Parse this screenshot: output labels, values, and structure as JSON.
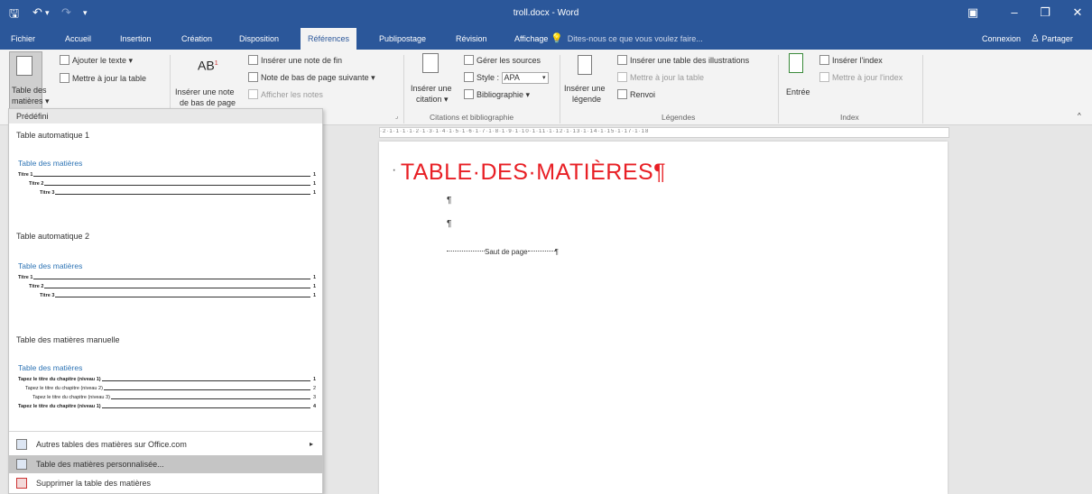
{
  "window": {
    "title": "troll.docx - Word",
    "quick_access": {
      "save_icon": "save-icon",
      "undo_icon": "undo-icon",
      "redo_icon": "redo-icon",
      "customize_icon": "customize-icon"
    },
    "controls": {
      "ribbon_display": "▣",
      "minimize": "–",
      "restore": "❐",
      "close": "✕"
    }
  },
  "tabs": [
    "Fichier",
    "Accueil",
    "Insertion",
    "Création",
    "Disposition",
    "Références",
    "Publipostage",
    "Révision",
    "Affichage"
  ],
  "active_tab": "Références",
  "tell_me": "Dites-nous ce que vous voulez faire...",
  "account": {
    "connexion": "Connexion",
    "partager": "Partager"
  },
  "ribbon": {
    "toc": {
      "btn_line1": "Table des",
      "btn_line2": "matières ▾",
      "add_text": "Ajouter le texte ▾",
      "update_table": "Mettre à jour la table"
    },
    "footnotes": {
      "insert_line1": "Insérer une note",
      "insert_line2": "de bas de page",
      "insert_endnote": "Insérer une note de fin",
      "next_footnote": "Note de bas de page suivante ▾",
      "show_notes": "Afficher les notes",
      "ab_icon": "AB"
    },
    "citations": {
      "insert_line1": "Insérer une",
      "insert_line2": "citation ▾",
      "manage_sources": "Gérer les sources",
      "style_label": "Style :",
      "style_value": "APA",
      "bibliography": "Bibliographie ▾",
      "group": "Citations et bibliographie"
    },
    "captions": {
      "insert_line1": "Insérer une",
      "insert_line2": "légende",
      "insert_table_fig": "Insérer une table des illustrations",
      "update_table": "Mettre à jour la table",
      "crossref": "Renvoi",
      "group": "Légendes"
    },
    "index": {
      "entry": "Entrée",
      "insert_index": "Insérer l'index",
      "update_index": "Mettre à jour l'index",
      "group": "Index"
    }
  },
  "dropdown": {
    "header": "Prédéfini",
    "sections": [
      {
        "title": "Table automatique 1",
        "preview_title": "Table des matières",
        "lines": [
          {
            "text": "Titre 1",
            "page": "1",
            "indent": 0,
            "bold": true
          },
          {
            "text": "Titre 2",
            "page": "1",
            "indent": 1,
            "bold": true
          },
          {
            "text": "Titre 3",
            "page": "1",
            "indent": 2,
            "bold": true
          }
        ]
      },
      {
        "title": "Table automatique 2",
        "preview_title": "Table des matières",
        "lines": [
          {
            "text": "Titre 1",
            "page": "1",
            "indent": 0,
            "bold": true
          },
          {
            "text": "Titre 2",
            "page": "1",
            "indent": 1,
            "bold": true
          },
          {
            "text": "Titre 3",
            "page": "1",
            "indent": 2,
            "bold": true
          }
        ]
      },
      {
        "title": "Table des matières manuelle",
        "preview_title": "Table des matières",
        "lines": [
          {
            "text": "Tapez le titre du chapitre (niveau 1)",
            "page": "1",
            "indent": 0,
            "bold": true
          },
          {
            "text": "Tapez le titre du chapitre (niveau 2)",
            "page": "2",
            "indent": 1,
            "bold": false
          },
          {
            "text": "Tapez le titre du chapitre (niveau 3)",
            "page": "3",
            "indent": 2,
            "bold": false
          },
          {
            "text": "Tapez le titre du chapitre (niveau 1)",
            "page": "4",
            "indent": 0,
            "bold": true
          }
        ]
      }
    ],
    "menu": [
      {
        "label": "Autres tables des matières sur Office.com",
        "icon": "office-icon",
        "arrow": "▸",
        "highlighted": false
      },
      {
        "label": "Table des matières personnalisée...",
        "icon": "custom-toc-icon",
        "arrow": "",
        "highlighted": true
      },
      {
        "label": "Supprimer la table des matières",
        "icon": "delete-toc-icon",
        "arrow": "",
        "highlighted": false
      }
    ]
  },
  "document": {
    "heading": "TABLE·DES·MATIÈRES¶",
    "bullet": "·",
    "pilcrow": "¶",
    "page_break": "Saut de page"
  },
  "ruler_text": "·2·1·1·1·1·2·1·3·1·4·1·5·1·6·1·7·1·8·1·9·1·10·1·11·1·12·1·13·1·14·1·15·1·17·1·18"
}
